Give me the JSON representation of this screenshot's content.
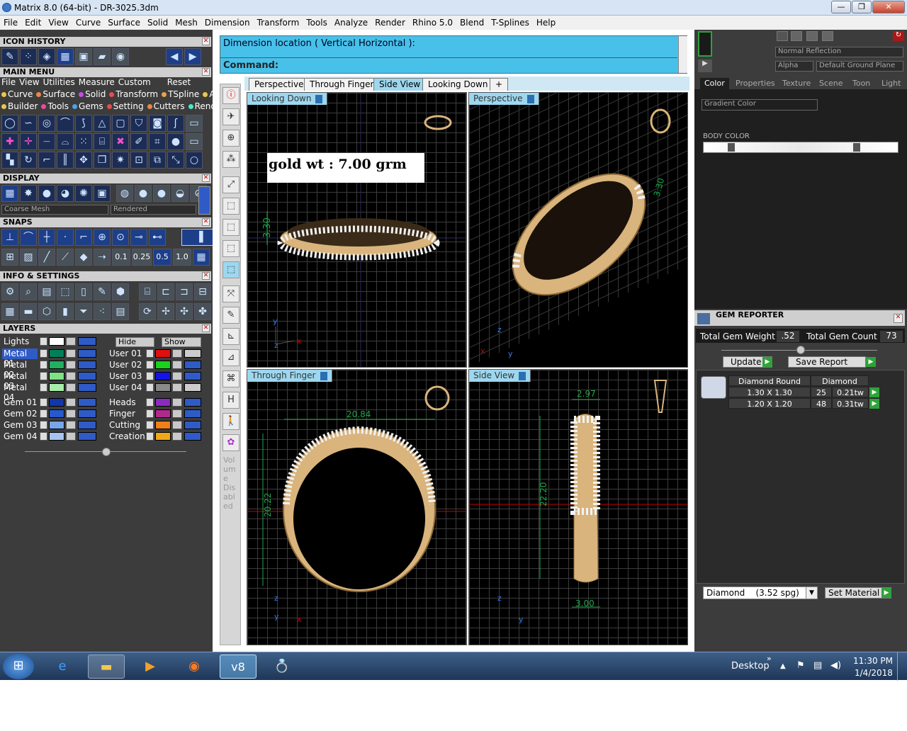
{
  "window": {
    "title": "Matrix 8.0 (64-bit) - DR-3025.3dm",
    "controls": [
      "—",
      "❐",
      "✕"
    ]
  },
  "menubar": [
    "File",
    "Edit",
    "View",
    "Curve",
    "Surface",
    "Solid",
    "Mesh",
    "Dimension",
    "Transform",
    "Tools",
    "Analyze",
    "Render",
    "Rhino 5.0",
    "Blend",
    "T-Splines",
    "Help"
  ],
  "left": {
    "icon_history": "ICON HISTORY",
    "main_menu": "MAIN MENU",
    "main_menu_row1": [
      "File",
      "View",
      "Utilities",
      "Measure",
      "Custom",
      "Reset"
    ],
    "main_menu_row2": [
      "Curve",
      "Surface",
      "Solid",
      "Transform",
      "TSpline",
      "Art"
    ],
    "main_menu_row3": [
      "Builder",
      "Tools",
      "Gems",
      "Setting",
      "Cutters",
      "Render"
    ],
    "display": "DISPLAY",
    "display_mesh": "Coarse Mesh",
    "display_mode": "Rendered",
    "snaps": "SNAPS",
    "snap_values": [
      "0.1",
      "0.25",
      "0.5",
      "1.0"
    ],
    "info_settings": "INFO & SETTINGS",
    "layers": "LAYERS",
    "lights": "Lights",
    "hide": "Hide",
    "show": "Show",
    "layer_left": [
      "Metal 01",
      "Metal 02",
      "Metal 03",
      "Metal 04",
      "Gem 01",
      "Gem 02",
      "Gem 03",
      "Gem 04"
    ],
    "layer_right": [
      "User 01",
      "User 02",
      "User 03",
      "User 04",
      "Heads",
      "Finger",
      "Cutting",
      "Creation"
    ],
    "layer_left_colors": [
      "#00805a",
      "#20b060",
      "#7ee087",
      "#a6eeaa",
      "#1237a8",
      "#2758d0",
      "#79a6ea",
      "#a6c4f1"
    ],
    "layer_right_colors": [
      "#e01010",
      "#19d219",
      "#1414e6",
      "#8a8a8a",
      "#8a2bbf",
      "#b02a8b",
      "#f07f18",
      "#f0a818"
    ]
  },
  "command": {
    "line1": "Dimension location ( Vertical  Horizontal ):",
    "line2": "Command:"
  },
  "viewtabs": [
    "Perspective",
    "Through Finger",
    "Side View",
    "Looking Down"
  ],
  "viewports": {
    "top_left": "Looking Down",
    "top_right": "Perspective",
    "bottom_left": "Through Finger",
    "bottom_right": "Side View"
  },
  "annotations": {
    "gold_weight": "gold wt : 7.00 grm",
    "dim_tl": "3.30",
    "dim_bl_width": "20.84",
    "dim_bl_height": "20.22",
    "dim_br_top": "2.97",
    "dim_br_height": "22.20",
    "dim_br_bottom": "3.00",
    "dim_tr": "3.30",
    "volume_label": "Vol um e Dis abl ed"
  },
  "right": {
    "reflection": "Normal Reflection",
    "alpha": "Alpha",
    "ground": "Default Ground Plane",
    "tabs": [
      "Color",
      "Properties",
      "Texture",
      "Scene",
      "Toon",
      "Light"
    ],
    "gradient": "Gradient Color",
    "body_color": "BODY COLOR",
    "gem_reporter": "GEM REPORTER",
    "total_weight_label": "Total Gem Weight",
    "total_weight": ".52",
    "total_count_label": "Total Gem Count",
    "total_count": "73",
    "update": "Update",
    "save_report": "Save Report",
    "table_headers": [
      "Diamond Round",
      "Diamond"
    ],
    "rows": [
      {
        "size": "1.30 X 1.30",
        "count": "25",
        "tw": "0.21tw"
      },
      {
        "size": "1.20 X 1.20",
        "count": "48",
        "tw": "0.31tw"
      }
    ],
    "material_select": "Diamond    (3.52 spg)",
    "set_material": "Set Material"
  },
  "taskbar": {
    "desktop": "Desktop",
    "time": "11:30 PM",
    "date": "1/4/2018"
  },
  "colors": {
    "accent": "#47c1ea",
    "viewport_bg": "#000000",
    "gold": "#d9b47c",
    "dimension": "#1fa64a"
  }
}
